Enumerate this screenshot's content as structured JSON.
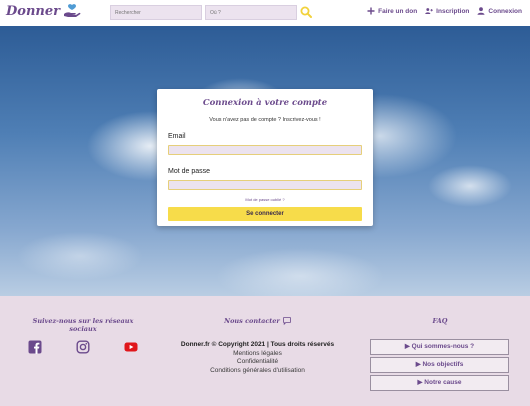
{
  "header": {
    "logo": "Donner",
    "search_what_placeholder": "Rechercher",
    "search_where_placeholder": "Où ?",
    "nav": {
      "donate": "Faire un don",
      "signup": "Inscription",
      "login": "Connexion"
    }
  },
  "login": {
    "title": "Connexion à votre compte",
    "subtitle": "Vous n'avez pas de compte ? Inscrivez-vous !",
    "email_label": "Email",
    "password_label": "Mot de passe",
    "forgot": "Mot de passe oublié ?",
    "submit": "Se connecter"
  },
  "footer": {
    "social_title": "Suivez-nous sur les réseaux sociaux",
    "contact_title": "Nous contacter",
    "faq_title": "FAQ",
    "copyright": "Donner.fr © Copyright 2021 | Tous droits réservés",
    "links": [
      "Mentions légales",
      "Confidentialité",
      "Conditions générales d'utilisation"
    ],
    "faq_items": [
      "▶ Qui sommes-nous ?",
      "▶ Nos objectifs",
      "▶ Notre cause"
    ]
  },
  "colors": {
    "brand_purple": "#6b4a8c",
    "accent_yellow": "#f7dc4a",
    "footer_bg": "#e8dbe6",
    "facebook": "#6b4a8c",
    "instagram": "#6b4a8c",
    "youtube": "#e0161b"
  },
  "icons": [
    "hand-heart-icon",
    "search-icon",
    "plus-icon",
    "user-plus-icon",
    "user-icon",
    "facebook-icon",
    "instagram-icon",
    "youtube-icon",
    "chat-icon"
  ]
}
